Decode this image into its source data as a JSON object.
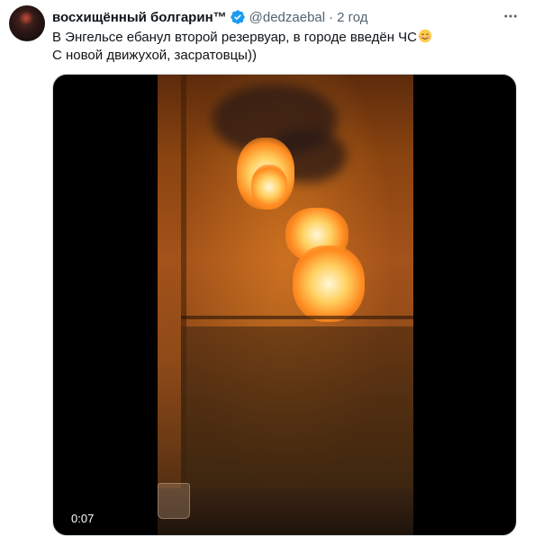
{
  "tweet": {
    "author_name": "восхищённый болгарин™",
    "handle": "@dedzaebal",
    "separator": "·",
    "time": "2 год",
    "text_line1": "В Энгельсе ебанул второй резервуар, в городе введён ЧС",
    "text_line2": "С новой движухой, засратовцы))",
    "emoji": "smiling-face-emoji",
    "verified_icon": "verified-badge-icon",
    "more_icon": "more-options-icon",
    "video": {
      "timestamp": "0:07",
      "scene": "night fire at fuel reservoirs seen through a window"
    },
    "colors": {
      "verified": "#1d9bf0",
      "secondary_text": "#536471",
      "primary_text": "#0f1419"
    }
  }
}
